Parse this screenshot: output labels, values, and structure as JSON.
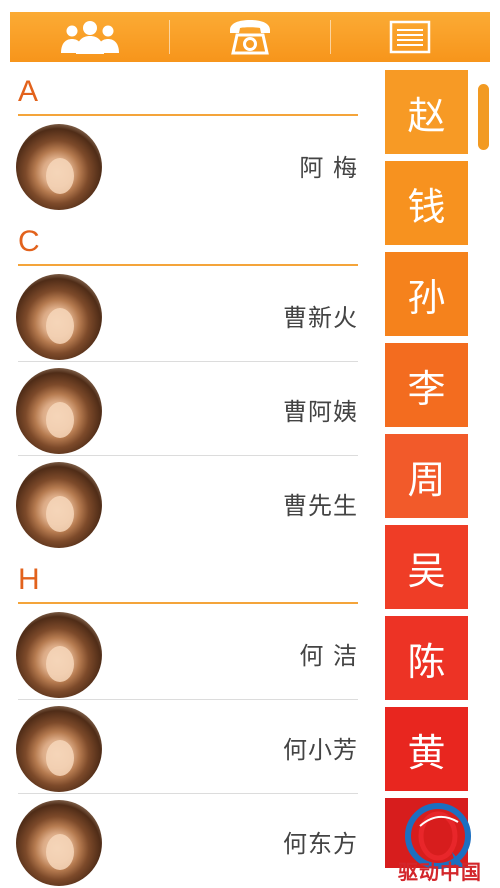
{
  "toolbar": {
    "buttons": [
      {
        "icon": "contacts-group-icon"
      },
      {
        "icon": "phone-icon"
      },
      {
        "icon": "menu-list-icon"
      }
    ],
    "background": "#f7951b"
  },
  "contacts": {
    "sections": [
      {
        "letter": "A",
        "contacts": [
          {
            "name": "阿 梅"
          }
        ]
      },
      {
        "letter": "C",
        "contacts": [
          {
            "name": "曹新火"
          },
          {
            "name": "曹阿姨"
          },
          {
            "name": "曹先生"
          }
        ]
      },
      {
        "letter": "H",
        "contacts": [
          {
            "name": "何 洁"
          },
          {
            "name": "何小芳"
          },
          {
            "name": "何东方"
          }
        ]
      }
    ]
  },
  "surname_index": {
    "items": [
      {
        "label": "赵",
        "color": "#f79a25"
      },
      {
        "label": "钱",
        "color": "#f7921f"
      },
      {
        "label": "孙",
        "color": "#f5821c"
      },
      {
        "label": "李",
        "color": "#f36c1f"
      },
      {
        "label": "周",
        "color": "#f25a2a"
      },
      {
        "label": "吴",
        "color": "#ef3d26"
      },
      {
        "label": "陈",
        "color": "#ed3325"
      },
      {
        "label": "黄",
        "color": "#e8261f"
      }
    ],
    "partial_color": "#d71d1d"
  },
  "watermark": {
    "text": "驱动中国"
  }
}
